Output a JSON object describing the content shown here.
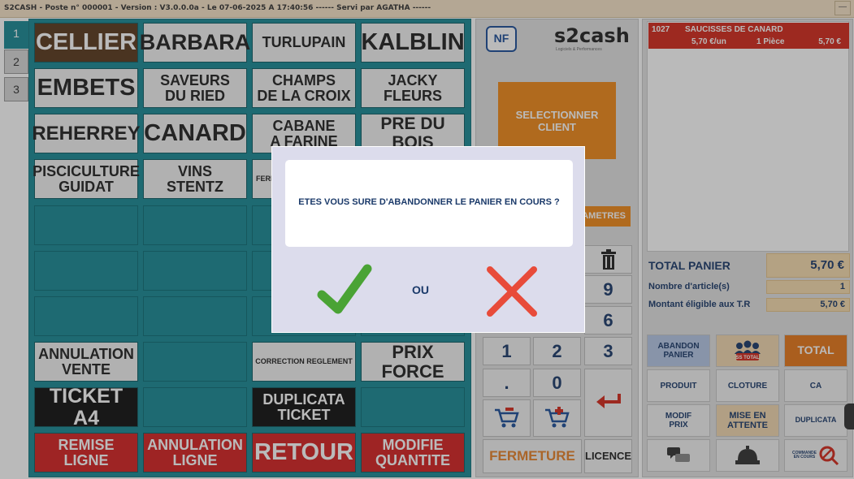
{
  "window": {
    "title": "S2CASH - Poste n° 000001 - Version : V3.0.0.0a - Le 07-06-2025 A 17:40:56 ------ Servi par AGATHA ------",
    "minimize": "—"
  },
  "tabs": [
    "1",
    "2",
    "3"
  ],
  "products": {
    "r1": [
      "CELLIER",
      "BARBARA",
      "TURLUPAIN",
      "KALBLIN"
    ],
    "r2": [
      [
        "EMBETS"
      ],
      [
        "SAVEURS",
        "DU RIED"
      ],
      [
        "CHAMPS",
        "DE LA CROIX"
      ],
      [
        "JACKY",
        "FLEURS"
      ]
    ],
    "r3": [
      [
        "REHERREY"
      ],
      [
        "CANARD"
      ],
      [
        "CABANE",
        "A FARINE"
      ],
      [
        "PRE DU BOIS"
      ]
    ],
    "r4": [
      [
        "PISCICULTURE",
        "GUIDAT"
      ],
      [
        "VINS",
        "STENTZ"
      ],
      [
        "FERME"
      ]
    ]
  },
  "functions": {
    "annulation_vente": [
      "ANNULATION",
      "VENTE"
    ],
    "correction_reglement": "CORRECTION REGLEMENT",
    "prix_force": "PRIX FORCE",
    "ticket_a4": "TICKET A4",
    "duplicata_ticket": [
      "DUPLICATA",
      "TICKET"
    ],
    "remise_ligne": [
      "REMISE",
      "LIGNE"
    ],
    "annulation_ligne": [
      "ANNULATION",
      "LIGNE"
    ],
    "retour": "RETOUR",
    "modifie_quantite": [
      "MODIFIE",
      "QUANTITE"
    ]
  },
  "middle": {
    "nf_logo": "NF",
    "brand": "s2cash",
    "brand_sub": "Logiciels & Performances",
    "select_client": [
      "SELECTIONNER",
      "CLIENT"
    ],
    "params": "AMETRES",
    "keys": {
      "k9": "9",
      "k6": "6",
      "k1": "1",
      "k2": "2",
      "k3": "3",
      "kdot": ".",
      "k0": "0"
    },
    "fermeture": "FERMETURE",
    "licence": "LICENCE"
  },
  "cart": {
    "line": {
      "code": "1027",
      "label": "SAUCISSES DE CANARD",
      "unit_price": "5,70 €/un",
      "qty": "1 Pièce",
      "price": "5,70 €"
    },
    "total_label": "TOTAL PANIER",
    "total_value": "5,70 €",
    "items_label": "Nombre d'article(s)",
    "items_value": "1",
    "eligible_label": "Montant éligible aux T.R",
    "eligible_value": "5,70 €"
  },
  "actions": {
    "abandon_panier": [
      "ABANDON",
      "PANIER"
    ],
    "ss_total": "SS TOTAL",
    "total": "TOTAL",
    "produit": "PRODUIT",
    "cloture": "CLOTURE",
    "ca": "CA",
    "modif_prix": [
      "MODIF",
      "PRIX"
    ],
    "mise_en_attente": [
      "MISE EN",
      "ATTENTE"
    ],
    "duplicata": "DUPLICATA",
    "commande_en_cours": [
      "COMMANDE",
      "EN COURS"
    ]
  },
  "modal": {
    "message": "ETES VOUS SURE D'ABANDONNER LE PANIER EN COURS ?",
    "or_label": "OU"
  }
}
